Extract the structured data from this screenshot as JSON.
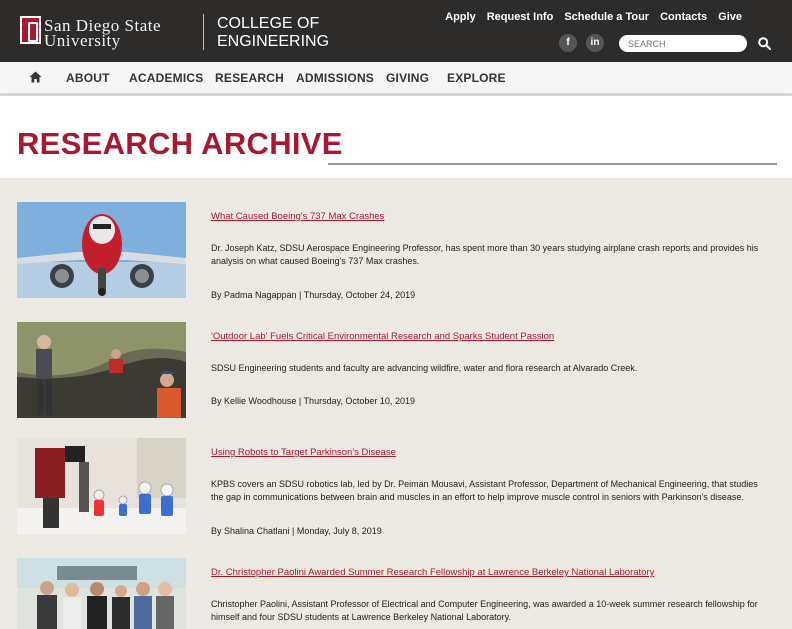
{
  "header": {
    "logo_line1": "San Diego State",
    "logo_line2": "University",
    "college_line1": "COLLEGE OF",
    "college_line2": "ENGINEERING",
    "util_links": [
      "Apply",
      "Request Info",
      "Schedule a Tour",
      "Contacts",
      "Give"
    ],
    "social": {
      "facebook": "f",
      "linkedin": "in"
    },
    "search_placeholder": "SEARCH"
  },
  "nav": {
    "home_icon": "home-icon",
    "items": [
      "ABOUT",
      "ACADEMICS",
      "RESEARCH",
      "ADMISSIONS",
      "GIVING",
      "EXPLORE"
    ]
  },
  "page": {
    "title": "RESEARCH ARCHIVE"
  },
  "articles": [
    {
      "title": "What Caused Boeing's 737 Max Crashes",
      "description": "Dr. Joseph Katz, SDSU Aerospace Engineering Professor, has spent more than 30 years studying airplane crash reports and provides his analysis on what caused Boeing's 737 Max crashes.",
      "meta": "By Padma Nagappan | Thursday, October 24, 2019"
    },
    {
      "title": "'Outdoor Lab' Fuels Critical Environmental Research and Sparks Student Passion",
      "description": "SDSU Engineering students and faculty are advancing wildfire, water and flora research at Alvarado Creek.",
      "meta": "By Kellie Woodhouse | Thursday, October 10, 2019"
    },
    {
      "title": "Using Robots to Target Parkinson's Disease",
      "description": "KPBS covers an SDSU robotics lab, led by Dr. Peiman Mousavi, Assistant Professor, Department of Mechanical Engineering,  that studies the gap in communications between brain and muscles in an effort to help improve muscle control in seniors with Parkinson's disease.",
      "meta": "By Shalina Chatlani | Monday, July 8, 2019"
    },
    {
      "title": "Dr. Christopher Paolini Awarded Summer Research Fellowship at Lawrence Berkeley National Laboratory",
      "description": "Christopher Paolini, Assistant Professor of Electrical and Computer Engineering, was awarded a 10-week summer research fellowship for himself and four SDSU students at Lawrence Berkeley National Laboratory.",
      "meta": ""
    }
  ],
  "colors": {
    "brand_red": "#a6192e",
    "header_bg": "#2d2c2a",
    "body_bg": "#ece9e2"
  }
}
